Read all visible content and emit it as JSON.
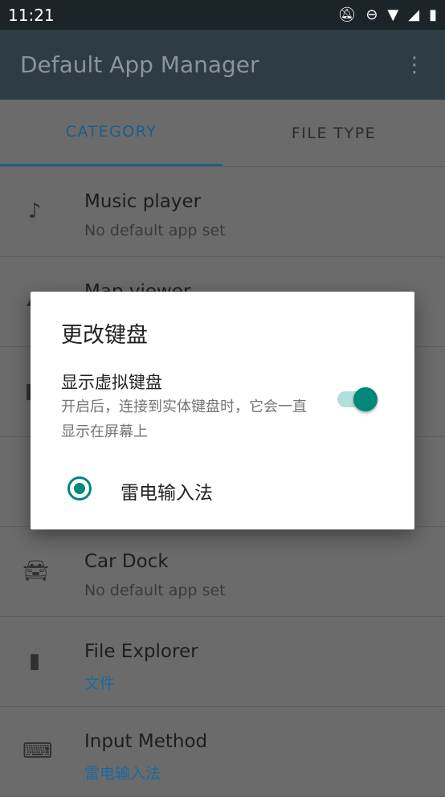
{
  "status_bar": {
    "time": "11:21",
    "icons": [
      "bell-off-icon",
      "do-not-disturb-icon",
      "wifi-icon",
      "signal-icon",
      "battery-charging-icon"
    ]
  },
  "app_bar": {
    "title": "Default App Manager",
    "menu_icon": "more-vert-icon"
  },
  "tabs": [
    {
      "label": "CATEGORY",
      "active": true
    },
    {
      "label": "FILE TYPE",
      "active": false
    }
  ],
  "list": [
    {
      "title": "Music player",
      "subtitle": "No default app set",
      "icon": "music-note-icon"
    },
    {
      "title": "Map viewer",
      "subtitle": "",
      "icon": "map-icon"
    },
    {
      "title": "",
      "subtitle": "",
      "icon": "unknown-icon"
    },
    {
      "title": "",
      "subtitle": "",
      "icon": "unknown-icon"
    },
    {
      "title": "Car Dock",
      "subtitle": "No default app set",
      "icon": "car-icon"
    },
    {
      "title": "File Explorer",
      "subtitle": "文件",
      "icon": "sd-card-icon"
    },
    {
      "title": "Input Method",
      "subtitle": "雷电输入法",
      "icon": "keyboard-icon"
    }
  ],
  "dialog": {
    "title": "更改键盘",
    "switch_label": "显示虚拟键盘",
    "switch_desc": "开启后，连接到实体键盘时，它会一直显示在屏幕上",
    "switch_on": true,
    "options": [
      {
        "label": "雷电输入法",
        "selected": true
      }
    ]
  },
  "colors": {
    "accent": "#00897b",
    "tab_accent": "#1c5f88"
  }
}
